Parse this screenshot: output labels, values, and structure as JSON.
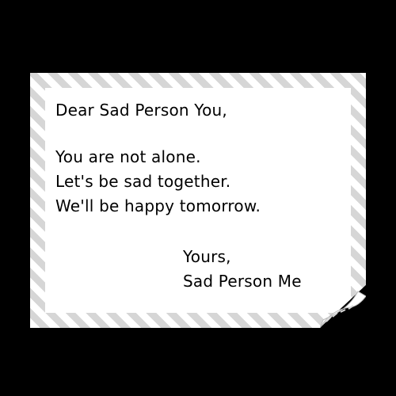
{
  "letter": {
    "salutation": "Dear Sad Person You,",
    "body": [
      "You are not alone.",
      "Let's be sad together.",
      "We'll be happy tomorrow."
    ],
    "closing": "Yours,",
    "signature": "Sad Person Me"
  },
  "colors": {
    "background": "#000000",
    "paper": "#ffffff",
    "border_stripe": "#d6d6d6",
    "text": "#000000"
  }
}
